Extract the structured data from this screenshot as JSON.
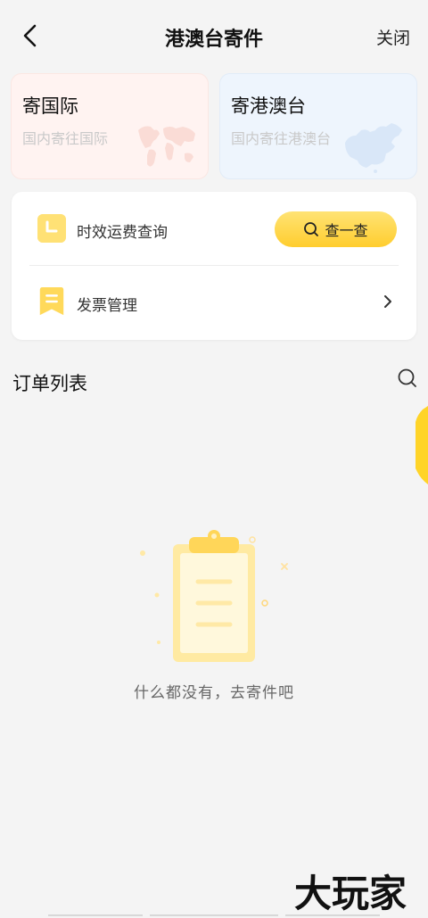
{
  "header": {
    "title": "港澳台寄件",
    "close_label": "关闭"
  },
  "cards": {
    "intl": {
      "title": "寄国际",
      "subtitle": "国内寄往国际"
    },
    "hk": {
      "title": "寄港澳台",
      "subtitle": "国内寄往港澳台"
    }
  },
  "tools": {
    "rate": {
      "label": "时效运费查询",
      "button_label": "查一查"
    },
    "invoice": {
      "label": "发票管理"
    }
  },
  "orders": {
    "title": "订单列表",
    "empty_text": "什么都没有，去寄件吧"
  },
  "watermark": {
    "text": "大玩家"
  },
  "colors": {
    "accent": "#ffcd2e",
    "background": "#f4f4f4",
    "card_intl": "#fff3f1",
    "card_hk": "#eef5fd"
  }
}
